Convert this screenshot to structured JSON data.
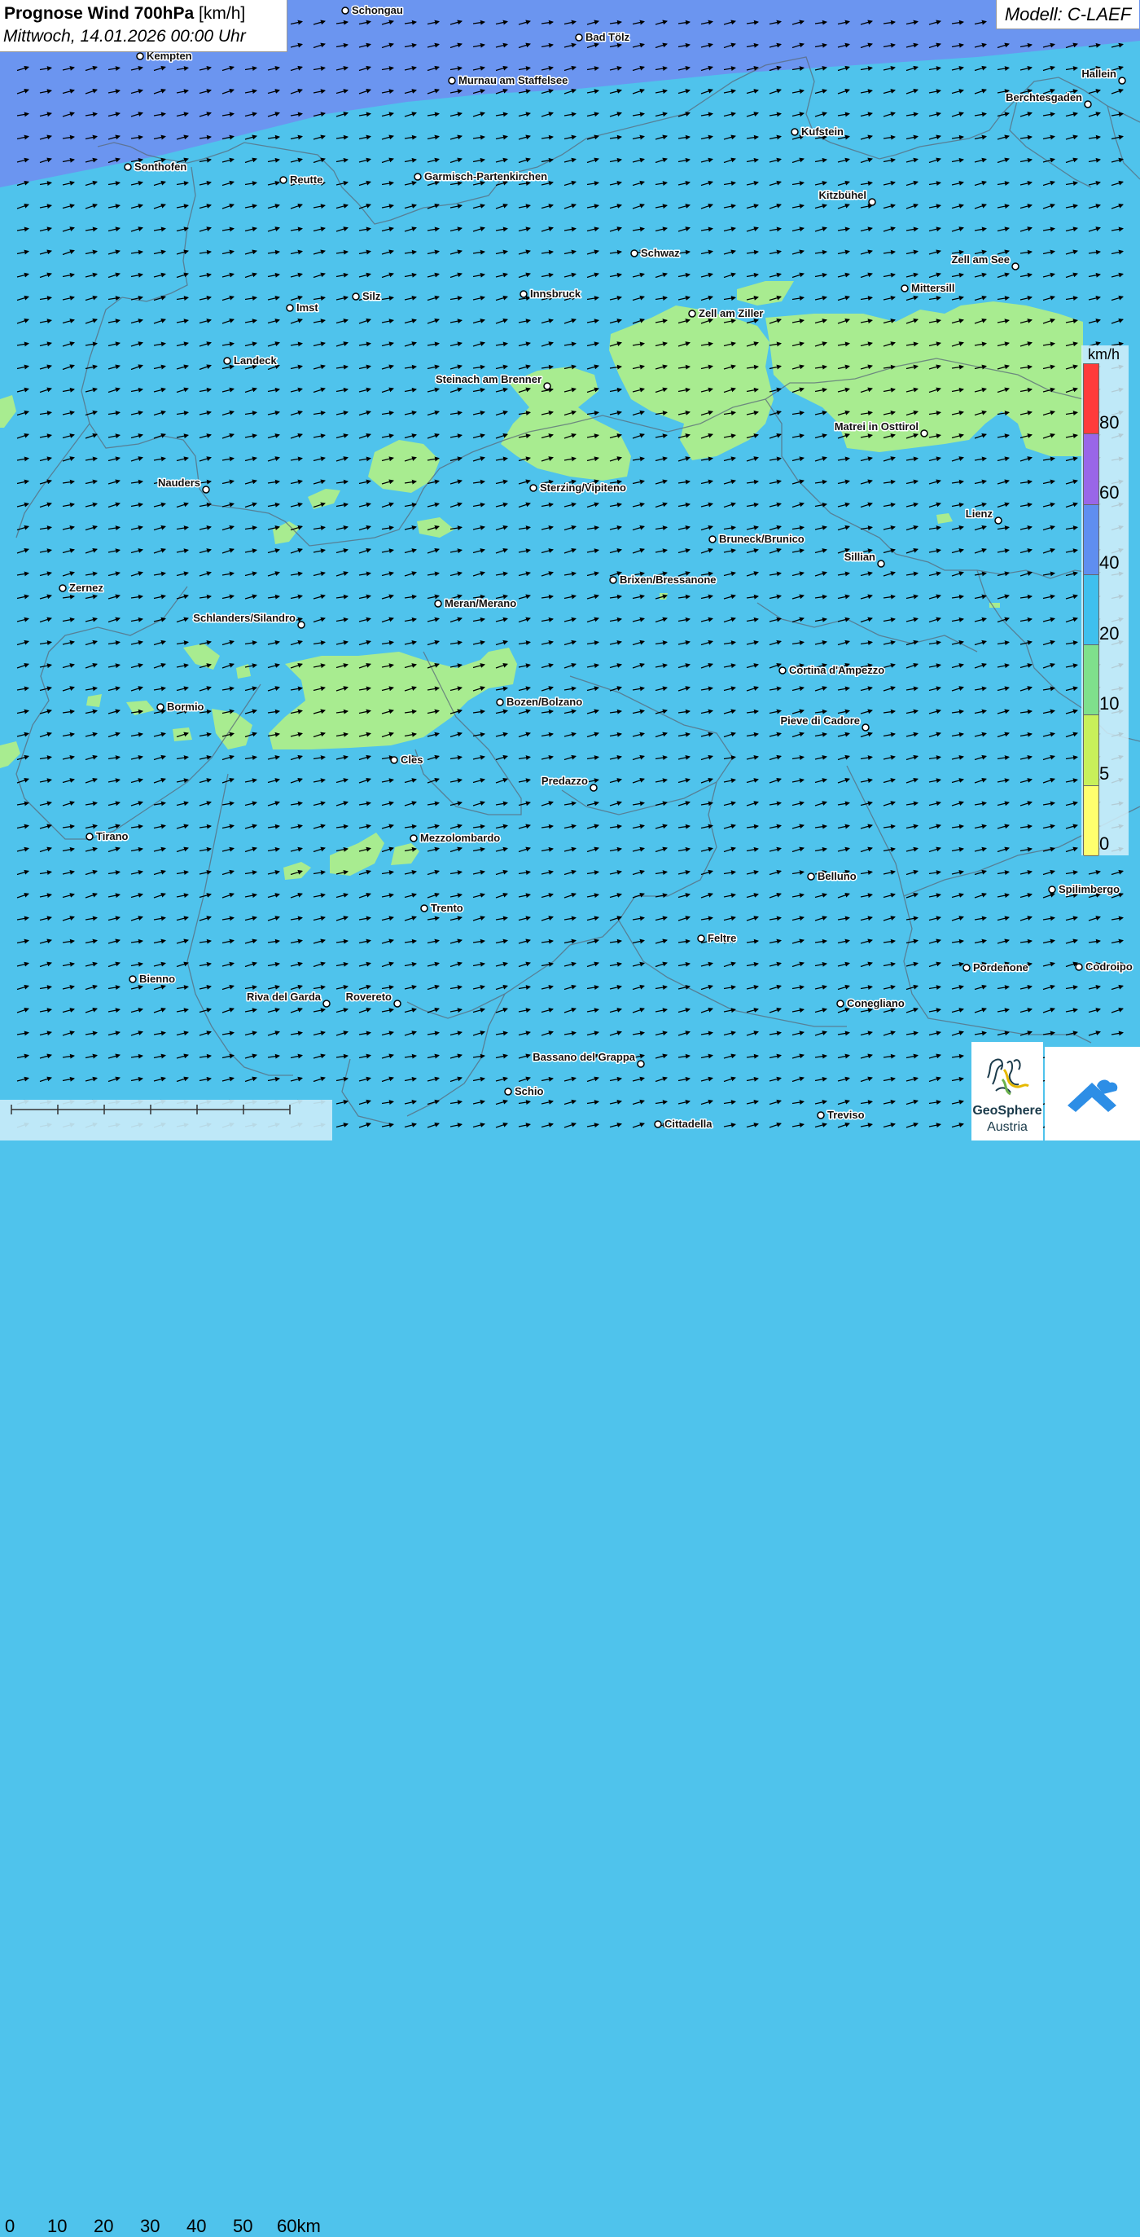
{
  "header": {
    "title_bold": "Prognose Wind 700hPa",
    "title_unit": " [km/h]",
    "datetime": "Mittwoch, 14.01.2026 00:00 Uhr",
    "model": "Modell: C-LAEF"
  },
  "legend": {
    "unit": "km/h",
    "ticks": [
      "80",
      "60",
      "40",
      "20",
      "10",
      "5",
      "0"
    ],
    "colors": [
      "#ff3b3b",
      "#9966e8",
      "#5f8ef0",
      "#3fc0ee",
      "#7fe08c",
      "#c8f05a",
      "#ffff6e"
    ]
  },
  "scale": {
    "labels": [
      "0",
      "10",
      "20",
      "30",
      "40",
      "50",
      "60km"
    ]
  },
  "logo": {
    "name_line1": "GeoSphere",
    "name_line2": "Austria"
  },
  "colors": {
    "band_0_5": "#ffff6e",
    "band_5_10": "#c8f05a",
    "band_10_20": "#a8ec90",
    "band_20_40": "#4fc3ec",
    "band_40_60": "#6b95f0",
    "band_60_80": "#9966e8",
    "band_80_plus": "#ff3b3b"
  },
  "cities": [
    {
      "name": "Schongau"
    },
    {
      "name": "Bad Tölz"
    },
    {
      "name": "Kempten"
    },
    {
      "name": "Murnau am Staffelsee"
    },
    {
      "name": "Hallein"
    },
    {
      "name": "Berchtesgaden"
    },
    {
      "name": "Kufstein"
    },
    {
      "name": "Sonthofen"
    },
    {
      "name": "Reutte"
    },
    {
      "name": "Garmisch-Partenkirchen"
    },
    {
      "name": "Kitzbühel"
    },
    {
      "name": "Schwaz"
    },
    {
      "name": "Zell am See"
    },
    {
      "name": "Mittersill"
    },
    {
      "name": "Innsbruck"
    },
    {
      "name": "Silz"
    },
    {
      "name": "Imst"
    },
    {
      "name": "Zell am Ziller"
    },
    {
      "name": "Landeck"
    },
    {
      "name": "Steinach am Brenner"
    },
    {
      "name": "Matrei in Osttirol"
    },
    {
      "name": "Nauders"
    },
    {
      "name": "Sterzing/Vipiteno"
    },
    {
      "name": "Lienz"
    },
    {
      "name": "Bruneck/Brunico"
    },
    {
      "name": "Sillian"
    },
    {
      "name": "Zernez"
    },
    {
      "name": "Brixen/Bressanone"
    },
    {
      "name": "Meran/Merano"
    },
    {
      "name": "Schlanders/Silandro"
    },
    {
      "name": "Cortina d'Ampezzo"
    },
    {
      "name": "Bormio"
    },
    {
      "name": "Bozen/Bolzano"
    },
    {
      "name": "Pieve di Cadore"
    },
    {
      "name": "Cles"
    },
    {
      "name": "Predazzo"
    },
    {
      "name": "Tirano"
    },
    {
      "name": "Mezzolombardo"
    },
    {
      "name": "Belluno"
    },
    {
      "name": "Spilimbergo"
    },
    {
      "name": "Trento"
    },
    {
      "name": "Feltre"
    },
    {
      "name": "Pordenone"
    },
    {
      "name": "Codroipo"
    },
    {
      "name": "Bienno"
    },
    {
      "name": "Riva del Garda"
    },
    {
      "name": "Rovereto"
    },
    {
      "name": "Conegliano"
    },
    {
      "name": "Bassano del Grappa"
    },
    {
      "name": "Schio"
    },
    {
      "name": "Treviso"
    },
    {
      "name": "Cittadella"
    }
  ]
}
